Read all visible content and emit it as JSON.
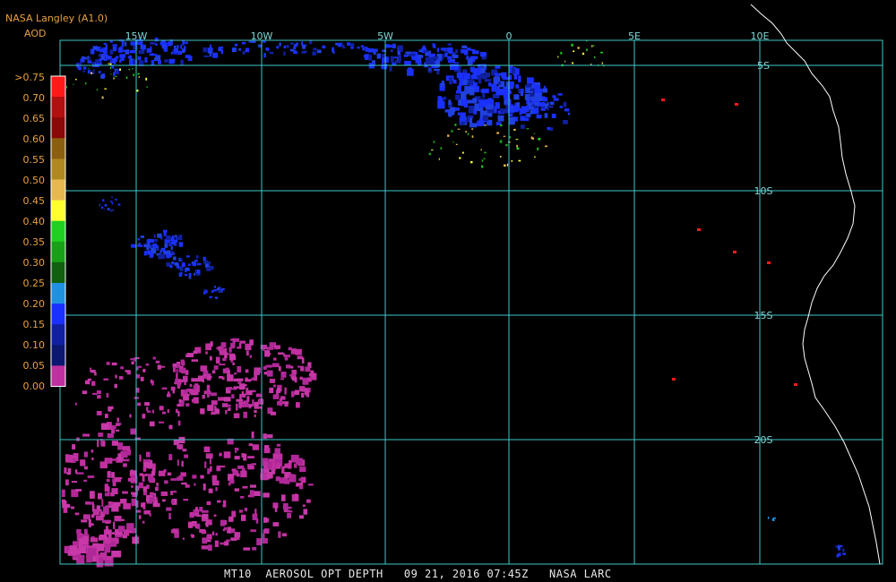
{
  "header": {
    "title": "NASA Langley (A1.0)",
    "subtitle": "AOD"
  },
  "footer": {
    "text": "MT10  AEROSOL OPT DEPTH   09 21, 2016 07:45Z   NASA LARC"
  },
  "grid": {
    "color": "#40c8c8",
    "lon_labels": [
      "15W",
      "10W",
      "5W",
      "0",
      "5E",
      "10E"
    ],
    "lat_labels": [
      "5S",
      "10S",
      "15S",
      "20S"
    ]
  },
  "legend": {
    "labels": [
      ">0.75",
      "0.70",
      "0.65",
      "0.60",
      "0.55",
      "0.50",
      "0.45",
      "0.40",
      "0.35",
      "0.30",
      "0.25",
      "0.20",
      "0.15",
      "0.10",
      "0.05",
      "0.00"
    ],
    "colors": [
      "#ff1a1a",
      "#b01010",
      "#8a0808",
      "#8a6010",
      "#b08820",
      "#e8b850",
      "#ffff30",
      "#20d020",
      "#18a018",
      "#106010",
      "#2090e0",
      "#1a30ff",
      "#1020a0",
      "#0c1870",
      "#c030a0"
    ]
  },
  "coastline_color": "#ffffff"
}
